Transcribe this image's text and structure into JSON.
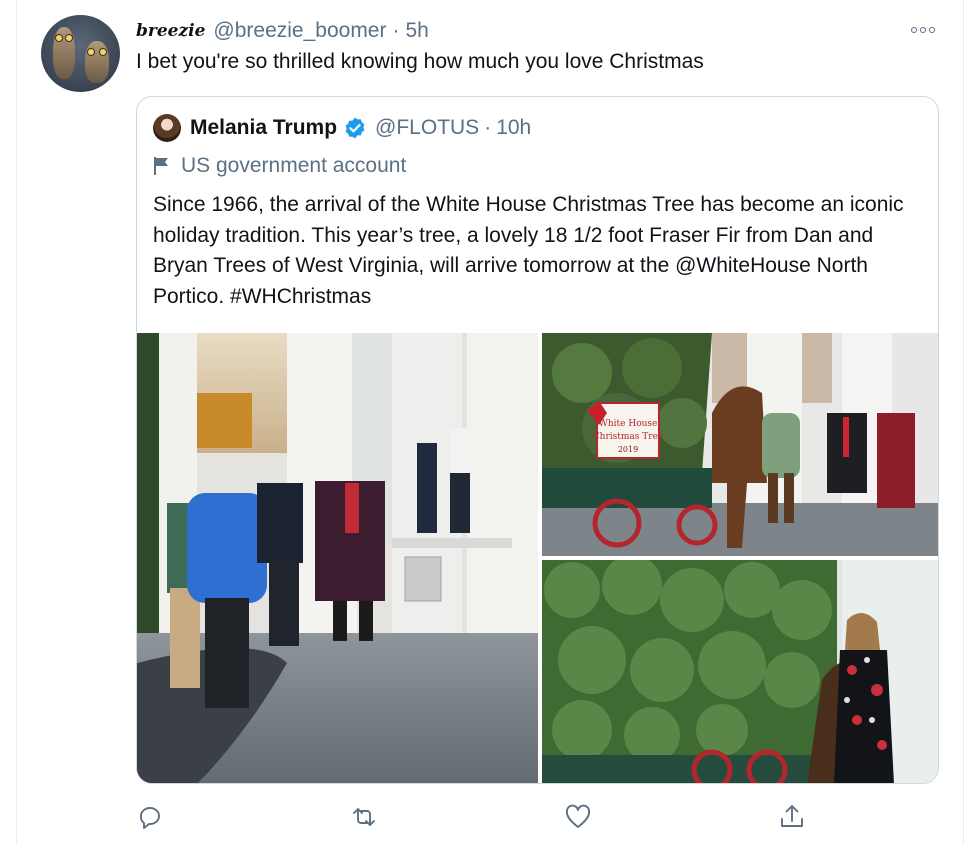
{
  "tweet": {
    "author_name": "breezie",
    "author_handle": "@breezie_boomer",
    "separator": "·",
    "time": "5h",
    "text": "I bet you're so thrilled knowing how much you love Christmas"
  },
  "quoted_tweet": {
    "author_name": "Melania Trump",
    "author_handle": "@FLOTUS",
    "separator": "·",
    "time": "10h",
    "label": "US government account",
    "text": "Since 1966, the arrival of the White House Christmas Tree has become an iconic holiday tradition. This year’s tree, a lovely 18 1/2 foot Fraser Fir from Dan and Bryan Trees of West Virginia, will arrive tomorrow at the @WhiteHouse North Portico. #WHChristmas",
    "sign_text": [
      "White House",
      "Christmas Tree",
      "2019"
    ]
  },
  "icons": {
    "more": "more-options-icon",
    "verified": "verified-badge-icon",
    "flag": "flag-icon",
    "reply": "reply-icon",
    "retweet": "retweet-icon",
    "like": "like-icon",
    "share": "share-icon"
  },
  "colors": {
    "text": "#0f1419",
    "muted": "#5b7083",
    "verified": "#1d9bf0",
    "border": "#cfd9de"
  }
}
